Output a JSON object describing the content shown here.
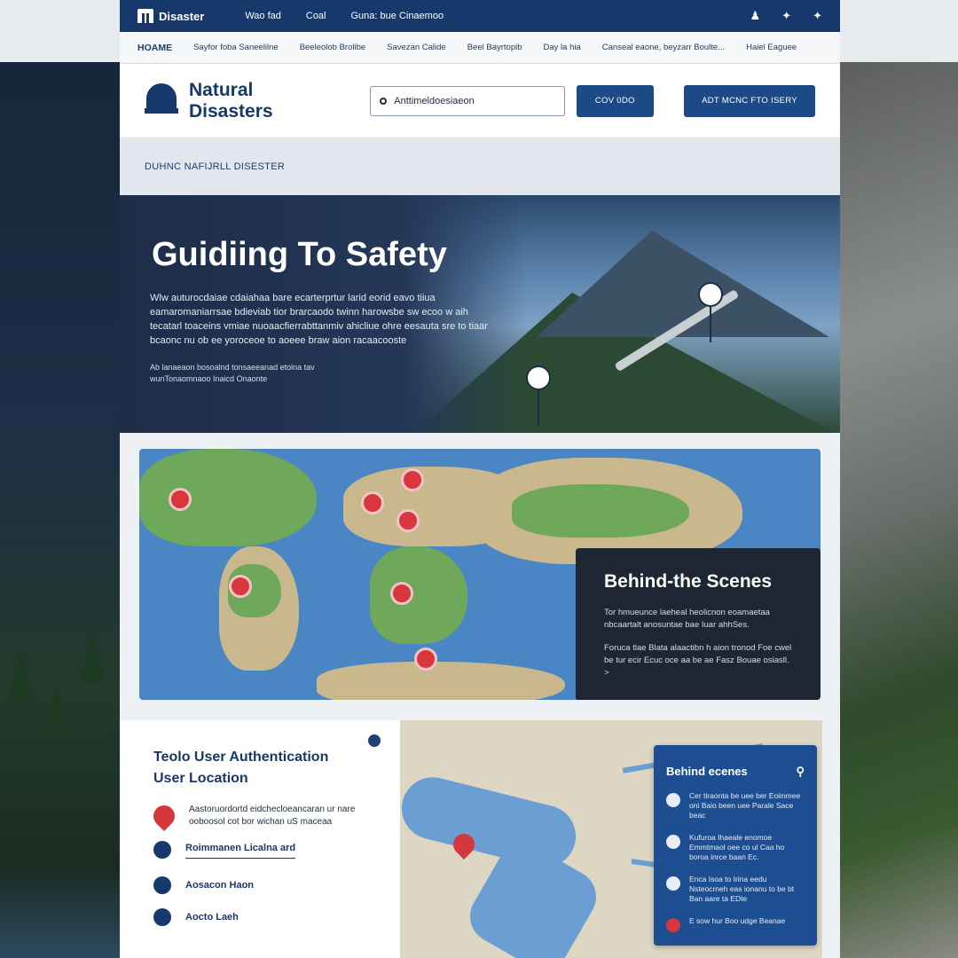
{
  "topnav": {
    "brand": "Disaster",
    "links": [
      "Wao fad",
      "Coal",
      "Guna: bue Cinaemoo"
    ],
    "social_icons": [
      "user-icon",
      "twitter-icon",
      "twitter-icon"
    ]
  },
  "subnav": {
    "items": [
      "HOAME",
      "Sayfor foba Saneelilne",
      "Beeleolob Brolibe",
      "Savezan Calide",
      "Beel Bayrtopib",
      "Day la hia",
      "Canseal eaone, beyzarr Boulte...",
      "Haiel Eaguee"
    ]
  },
  "header": {
    "logo_line1": "Natural",
    "logo_line2": "Disasters",
    "search_value": "Anttimeldoesiaeon",
    "btn1": "COV 0DO",
    "btn2": "ADT MCNC FTO ISERY"
  },
  "breadcrumb": "DUHNC NAFIJRLL DISESTER",
  "hero": {
    "title": "Guidiing To Safety",
    "para": "Wlw auturocdaiae cdaiahaa bare ecarterprtur larid eorid eavo tiiua eamaromaniarrsae bdieviab tior brarcaodo twinn harowsbe sw ecoo w aih tecatarl toaceins vmiae nuoaacfierrabttanmiv ahicliue ohre eesauta sre to tiaar bcaonc nu ob ee yoroceoe to aoeee braw aion racaacooste",
    "byline": "Ab lanaeaon bosoalnd tonsaeeanad etolna tav wunTonaomnaoo Inaicd Onaonte"
  },
  "map_card": {
    "title": "Behind-the Scenes",
    "p1": "Tor hmueunce laeheal heolicnon eoamaetaa nbcaartalt anosuntae bae Iuar ahhSes.",
    "p2": "Foruca tlae Blata alaactibn h aion tronod Foe cwel be tur ecir Ecuc oce aa be ae Fasz Bouae osiasll. >"
  },
  "auth": {
    "title_line1": "Teolo User Authentication",
    "title_line2": "User Location",
    "desc": "Aastoruordortd eidchecloeancaran ur nare ooboosol cot bor wichan uS maceaa",
    "link": "Roimmanen Licalna ard",
    "item1": "Aosacon Haon",
    "item2": "Aocto Laeh"
  },
  "panel": {
    "title": "Behind ecenes",
    "entries": [
      "Cer tiraonta be uee ber Eoiinmee oni Baio been uee Parale Sace beac",
      "Kufuroa Ihaeale enomoe Emmtmaol oee co ul Caa ho boroa inrce baan Ec.",
      "Enca Isoa to Irina eedu Nsteocrneh eas ionanu to be bt Ban aare ta EDte",
      "E sow hur Boo udge Beanae"
    ]
  },
  "colors": {
    "navy": "#16386a",
    "accent_red": "#d6363e",
    "panel_blue": "#1d4e91"
  }
}
